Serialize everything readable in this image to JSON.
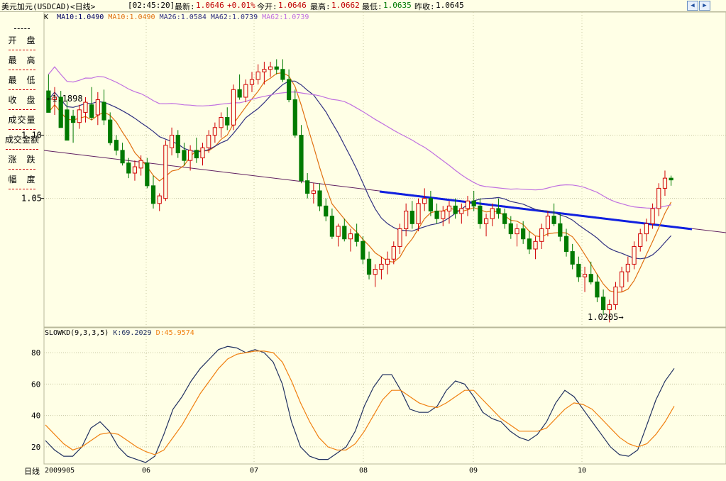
{
  "header": {
    "title": "美元加元(USDCAD)<日线>",
    "time": "[02:45:20]",
    "latest_label": "最新:",
    "latest_value": "1.0646",
    "change": "+0.01%",
    "open_label": "今开:",
    "open_value": "1.0646",
    "high_label": "最高:",
    "high_value": "1.0662",
    "low_label": "最低:",
    "low_value": "1.0635",
    "prev_label": "昨收:",
    "prev_value": "1.0645"
  },
  "ma_legend": {
    "k_label": "K",
    "ma10_a": "MA10:1.0490",
    "ma10_b": "MA10:1.0490",
    "ma26": "MA26:1.0584",
    "ma62a": "MA62:1.0739",
    "ma62b": "MA62:1.0739"
  },
  "sidebar": {
    "items": [
      "开　盘",
      "最　高",
      "最　低",
      "收　盘",
      "成交量",
      "成交金额",
      "涨　跌",
      "幅　度"
    ]
  },
  "kd_legend": {
    "name": "SLOWKD(9,3,3,5)",
    "k": "K:69.2029",
    "d": "D:45.9574"
  },
  "period_label": "日线",
  "colors": {
    "up": "#d00000",
    "down": "#007a00",
    "ma10": "#e07010",
    "ma26": "#303080",
    "ma62": "#c070e0",
    "trend": "#1020e0",
    "longtrend": "#602060",
    "grid": "#c8c8a0",
    "k_line": "#203060",
    "d_line": "#f08010"
  },
  "chart_data": [
    {
      "type": "candlestick",
      "ylim": [
        1.015,
        1.19
      ],
      "y_ticks": [
        "1.10",
        "1.05"
      ],
      "x_ticks": [
        "2009905",
        "06",
        "07",
        "08",
        "09",
        "10"
      ],
      "annotations": [
        "1.1898",
        "1.0205"
      ],
      "candles": [
        [
          1.135,
          1.148,
          1.12,
          1.118
        ],
        [
          1.128,
          1.138,
          1.116,
          1.13
        ],
        [
          1.13,
          1.135,
          1.108,
          1.106
        ],
        [
          1.12,
          1.128,
          1.098,
          1.096
        ],
        [
          1.115,
          1.12,
          1.094,
          1.11
        ],
        [
          1.11,
          1.124,
          1.105,
          1.12
        ],
        [
          1.118,
          1.13,
          1.11,
          1.126
        ],
        [
          1.124,
          1.138,
          1.112,
          1.114
        ],
        [
          1.116,
          1.134,
          1.108,
          1.128
        ],
        [
          1.126,
          1.136,
          1.108,
          1.112
        ],
        [
          1.112,
          1.118,
          1.092,
          1.094
        ],
        [
          1.096,
          1.1,
          1.084,
          1.088
        ],
        [
          1.088,
          1.094,
          1.076,
          1.078
        ],
        [
          1.078,
          1.082,
          1.066,
          1.07
        ],
        [
          1.07,
          1.08,
          1.064,
          1.075
        ],
        [
          1.074,
          1.084,
          1.068,
          1.08
        ],
        [
          1.078,
          1.082,
          1.058,
          1.06
        ],
        [
          1.06,
          1.068,
          1.042,
          1.046
        ],
        [
          1.046,
          1.054,
          1.04,
          1.052
        ],
        [
          1.05,
          1.096,
          1.048,
          1.092
        ],
        [
          1.09,
          1.106,
          1.084,
          1.1
        ],
        [
          1.1,
          1.104,
          1.082,
          1.086
        ],
        [
          1.088,
          1.094,
          1.076,
          1.08
        ],
        [
          1.08,
          1.092,
          1.072,
          1.088
        ],
        [
          1.088,
          1.098,
          1.078,
          1.082
        ],
        [
          1.082,
          1.094,
          1.076,
          1.09
        ],
        [
          1.09,
          1.104,
          1.086,
          1.1
        ],
        [
          1.1,
          1.11,
          1.094,
          1.106
        ],
        [
          1.106,
          1.118,
          1.098,
          1.114
        ],
        [
          1.114,
          1.122,
          1.104,
          1.108
        ],
        [
          1.108,
          1.14,
          1.104,
          1.136
        ],
        [
          1.136,
          1.148,
          1.128,
          1.13
        ],
        [
          1.13,
          1.144,
          1.126,
          1.14
        ],
        [
          1.14,
          1.15,
          1.134,
          1.144
        ],
        [
          1.144,
          1.156,
          1.14,
          1.15
        ],
        [
          1.15,
          1.158,
          1.14,
          1.152
        ],
        [
          1.152,
          1.158,
          1.146,
          1.154
        ],
        [
          1.154,
          1.16,
          1.148,
          1.152
        ],
        [
          1.152,
          1.16,
          1.142,
          1.144
        ],
        [
          1.144,
          1.152,
          1.126,
          1.128
        ],
        [
          1.128,
          1.136,
          1.098,
          1.1
        ],
        [
          1.1,
          1.108,
          1.062,
          1.064
        ],
        [
          1.064,
          1.07,
          1.05,
          1.054
        ],
        [
          1.054,
          1.062,
          1.046,
          1.056
        ],
        [
          1.056,
          1.062,
          1.04,
          1.044
        ],
        [
          1.044,
          1.05,
          1.032,
          1.036
        ],
        [
          1.036,
          1.042,
          1.018,
          1.02
        ],
        [
          1.02,
          1.03,
          1.012,
          1.028
        ],
        [
          1.028,
          1.034,
          1.016,
          1.018
        ],
        [
          1.018,
          1.026,
          1.008,
          1.022
        ],
        [
          1.022,
          1.03,
          1.012,
          1.016
        ],
        [
          1.016,
          1.02,
          0.998,
          1.002
        ],
        [
          1.002,
          1.008,
          0.986,
          0.99
        ],
        [
          0.99,
          0.998,
          0.98,
          0.994
        ],
        [
          0.994,
          1.004,
          0.986,
          0.998
        ],
        [
          0.998,
          1.008,
          0.99,
          1.002
        ],
        [
          1.002,
          1.016,
          0.998,
          1.012
        ],
        [
          1.012,
          1.03,
          1.006,
          1.026
        ],
        [
          1.026,
          1.046,
          1.02,
          1.04
        ],
        [
          1.04,
          1.048,
          1.026,
          1.03
        ],
        [
          1.03,
          1.05,
          1.024,
          1.046
        ],
        [
          1.046,
          1.058,
          1.04,
          1.05
        ],
        [
          1.05,
          1.056,
          1.036,
          1.04
        ],
        [
          1.04,
          1.046,
          1.03,
          1.034
        ],
        [
          1.034,
          1.044,
          1.028,
          1.04
        ],
        [
          1.04,
          1.048,
          1.03,
          1.044
        ],
        [
          1.044,
          1.05,
          1.034,
          1.038
        ],
        [
          1.038,
          1.046,
          1.03,
          1.042
        ],
        [
          1.042,
          1.052,
          1.036,
          1.048
        ],
        [
          1.048,
          1.056,
          1.04,
          1.044
        ],
        [
          1.044,
          1.05,
          1.026,
          1.03
        ],
        [
          1.03,
          1.038,
          1.02,
          1.034
        ],
        [
          1.034,
          1.046,
          1.028,
          1.042
        ],
        [
          1.042,
          1.05,
          1.034,
          1.038
        ],
        [
          1.038,
          1.042,
          1.026,
          1.03
        ],
        [
          1.03,
          1.036,
          1.018,
          1.022
        ],
        [
          1.022,
          1.03,
          1.012,
          1.026
        ],
        [
          1.026,
          1.032,
          1.014,
          1.018
        ],
        [
          1.018,
          1.024,
          1.006,
          1.01
        ],
        [
          1.01,
          1.02,
          1.002,
          1.016
        ],
        [
          1.016,
          1.03,
          1.01,
          1.026
        ],
        [
          1.026,
          1.04,
          1.02,
          1.036
        ],
        [
          1.036,
          1.046,
          1.028,
          1.03
        ],
        [
          1.03,
          1.038,
          1.016,
          1.02
        ],
        [
          1.02,
          1.026,
          1.004,
          1.008
        ],
        [
          1.008,
          1.014,
          0.994,
          0.998
        ],
        [
          0.998,
          1.004,
          0.984,
          0.988
        ],
        [
          0.988,
          0.996,
          0.976,
          0.99
        ],
        [
          0.99,
          1.0,
          0.982,
          0.984
        ],
        [
          0.984,
          0.99,
          0.968,
          0.972
        ],
        [
          0.972,
          0.978,
          0.958,
          0.962
        ],
        [
          0.962,
          0.97,
          0.952,
          0.966
        ],
        [
          0.966,
          0.984,
          0.962,
          0.98
        ],
        [
          0.98,
          0.996,
          0.976,
          0.992
        ],
        [
          0.992,
          1.004,
          0.984,
          0.998
        ],
        [
          0.998,
          1.016,
          0.994,
          1.012
        ],
        [
          1.012,
          1.026,
          1.008,
          1.022
        ],
        [
          1.022,
          1.034,
          1.016,
          1.03
        ],
        [
          1.03,
          1.046,
          1.026,
          1.042
        ],
        [
          1.042,
          1.062,
          1.036,
          1.058
        ],
        [
          1.058,
          1.072,
          1.052,
          1.066
        ],
        [
          1.066,
          1.068,
          1.06,
          1.0646
        ]
      ]
    },
    {
      "type": "line",
      "title": "SLOWKD(9,3,3,5)",
      "ylim": [
        10,
        90
      ],
      "y_ticks": [
        "80",
        "60",
        "40",
        "20"
      ],
      "series": [
        {
          "name": "K",
          "values": [
            24,
            18,
            14,
            14,
            20,
            32,
            36,
            30,
            20,
            14,
            12,
            10,
            14,
            28,
            44,
            52,
            62,
            70,
            76,
            82,
            84,
            83,
            80,
            82,
            80,
            74,
            60,
            36,
            20,
            14,
            12,
            12,
            16,
            20,
            30,
            46,
            58,
            66,
            66,
            56,
            44,
            42,
            42,
            46,
            56,
            62,
            60,
            52,
            42,
            38,
            36,
            30,
            26,
            24,
            28,
            36,
            48,
            56,
            52,
            44,
            36,
            28,
            20,
            15,
            14,
            18,
            34,
            50,
            62,
            70
          ]
        },
        {
          "name": "D",
          "values": [
            34,
            28,
            22,
            18,
            20,
            24,
            28,
            29,
            28,
            24,
            20,
            17,
            15,
            18,
            26,
            34,
            44,
            54,
            62,
            70,
            76,
            79,
            80,
            81,
            81,
            80,
            74,
            62,
            48,
            36,
            26,
            20,
            18,
            18,
            22,
            30,
            40,
            50,
            56,
            56,
            52,
            48,
            46,
            45,
            48,
            52,
            56,
            56,
            50,
            44,
            38,
            34,
            30,
            30,
            30,
            32,
            38,
            44,
            48,
            47,
            44,
            38,
            32,
            26,
            22,
            20,
            22,
            28,
            36,
            46
          ]
        }
      ]
    }
  ]
}
